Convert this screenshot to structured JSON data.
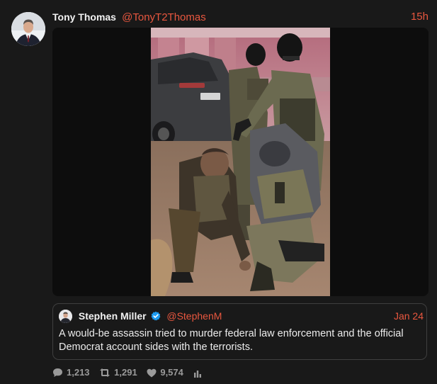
{
  "post": {
    "author": {
      "name": "Tony Thomas",
      "handle": "@TonyT2Thomas"
    },
    "timestamp": "15h",
    "accent_color": "#e9573f",
    "media": {
      "kind": "photo"
    },
    "quote": {
      "author": {
        "name": "Stephen Miller",
        "handle": "@StephenM",
        "verified": true
      },
      "date": "Jan 24",
      "text": "A would-be assassin tried to murder federal law enforcement and the official Democrat account sides with the terrorists."
    },
    "stats": {
      "replies": "1,213",
      "reposts": "1,291",
      "likes": "9,574"
    },
    "icons": {
      "reply": "speech-bubble-icon",
      "repost": "repost-icon",
      "like": "heart-icon",
      "analytics": "bar-chart-icon",
      "verified": "verified-check-icon"
    }
  }
}
